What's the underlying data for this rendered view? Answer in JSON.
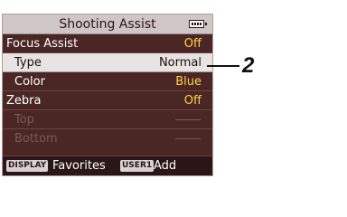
{
  "menu": {
    "title": "Shooting Assist",
    "battery_icon": "battery-icon",
    "rows": [
      {
        "label": "Focus Assist",
        "value": "Off",
        "style": "top"
      },
      {
        "label": "Type",
        "value": "Normal",
        "style": "indent selected"
      },
      {
        "label": "Color",
        "value": "Blue",
        "style": "indent"
      },
      {
        "label": "Zebra",
        "value": "Off",
        "style": "top"
      },
      {
        "label": "Top",
        "value": "—",
        "style": "indent dim"
      },
      {
        "label": "Bottom",
        "value": "—",
        "style": "indent dim"
      }
    ]
  },
  "footer": {
    "display_badge": "DISPLAY",
    "display_text": "Favorites",
    "user_badge": "USER1",
    "user_text": "Add"
  },
  "callout": {
    "number": "2"
  },
  "colors": {
    "background": "#4a2624",
    "value": "#ffd24a",
    "selected_row": "#e8e4e3"
  }
}
